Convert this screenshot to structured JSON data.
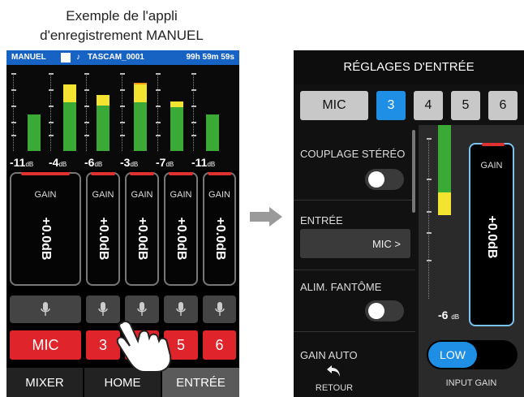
{
  "caption": {
    "line1": "Exemple de l'appli",
    "line2": "d'enregistrement MANUEL"
  },
  "left_app": {
    "statusbar": {
      "mode": "MANUEL",
      "note_icon": "♪",
      "file_name": "TASCAM_0001",
      "remaining_time": "99h 59m 59s"
    },
    "channels": [
      {
        "level_db": "-11",
        "unit": "dB",
        "gain_title": "GAIN",
        "gain_value": "+0.0dB",
        "source": "MIC",
        "level_fraction": 0.47,
        "peak_fraction": 0.47
      },
      {
        "level_db": "-4",
        "unit": "dB",
        "gain_title": "GAIN",
        "gain_value": "+0.0dB",
        "source": "3",
        "level_fraction": 0.63,
        "peak_fraction": 0.85
      },
      {
        "level_db": "-6",
        "unit": "dB",
        "gain_title": "GAIN",
        "gain_value": "+0.0dB",
        "source": "",
        "level_fraction": 0.58,
        "peak_fraction": 0.72
      },
      {
        "level_db": "-3",
        "unit": "dB",
        "gain_title": "GAIN",
        "gain_value": "+0.0dB",
        "source": "5",
        "level_fraction": 0.63,
        "peak_fraction": 0.88
      },
      {
        "level_db": "-7",
        "unit": "dB",
        "gain_title": "GAIN",
        "gain_value": "+0.0dB",
        "source": "",
        "level_fraction": 0.56,
        "peak_fraction": 0.64
      },
      {
        "level_db": "-11",
        "unit": "dB",
        "gain_title": "GAIN",
        "gain_value": "+0.0dB",
        "source": "6",
        "level_fraction": 0.47,
        "peak_fraction": 0.47
      }
    ],
    "bottom_tabs": [
      "MIXER",
      "HOME",
      "ENTRÉE"
    ],
    "colors": {
      "statusbar": "#1763c4",
      "source_red": "#e0242c",
      "meter_green": "#3aa935",
      "meter_yellow": "#f2e430",
      "meter_orange": "#f39a12"
    }
  },
  "right_app": {
    "title": "RÉGLAGES D'ENTRÉE",
    "channel_tabs": [
      {
        "label": "MIC",
        "active": false
      },
      {
        "label": "3",
        "active": true
      },
      {
        "label": "4",
        "active": false
      },
      {
        "label": "5",
        "active": false
      },
      {
        "label": "6",
        "active": false
      }
    ],
    "settings": {
      "stereo_link_label": "COUPLAGE STÉRÉO",
      "input_label": "ENTRÉE",
      "input_value": "MIC >",
      "phantom_label": "ALIM. FANTÔME",
      "auto_gain_label": "GAIN AUTO"
    },
    "meter": {
      "level_db": "-6",
      "unit": "dB",
      "level_fraction": 0.58,
      "peak_fraction": 0.78
    },
    "gain": {
      "title": "GAIN",
      "value": "+0.0dB"
    },
    "input_gain": {
      "selected": "LOW",
      "label": "INPUT GAIN"
    },
    "back": {
      "label": "RETOUR",
      "icon": "back-arrow-icon"
    },
    "colors": {
      "accent_blue": "#1f8fe6",
      "gain_outline": "#7ac3f0"
    }
  }
}
